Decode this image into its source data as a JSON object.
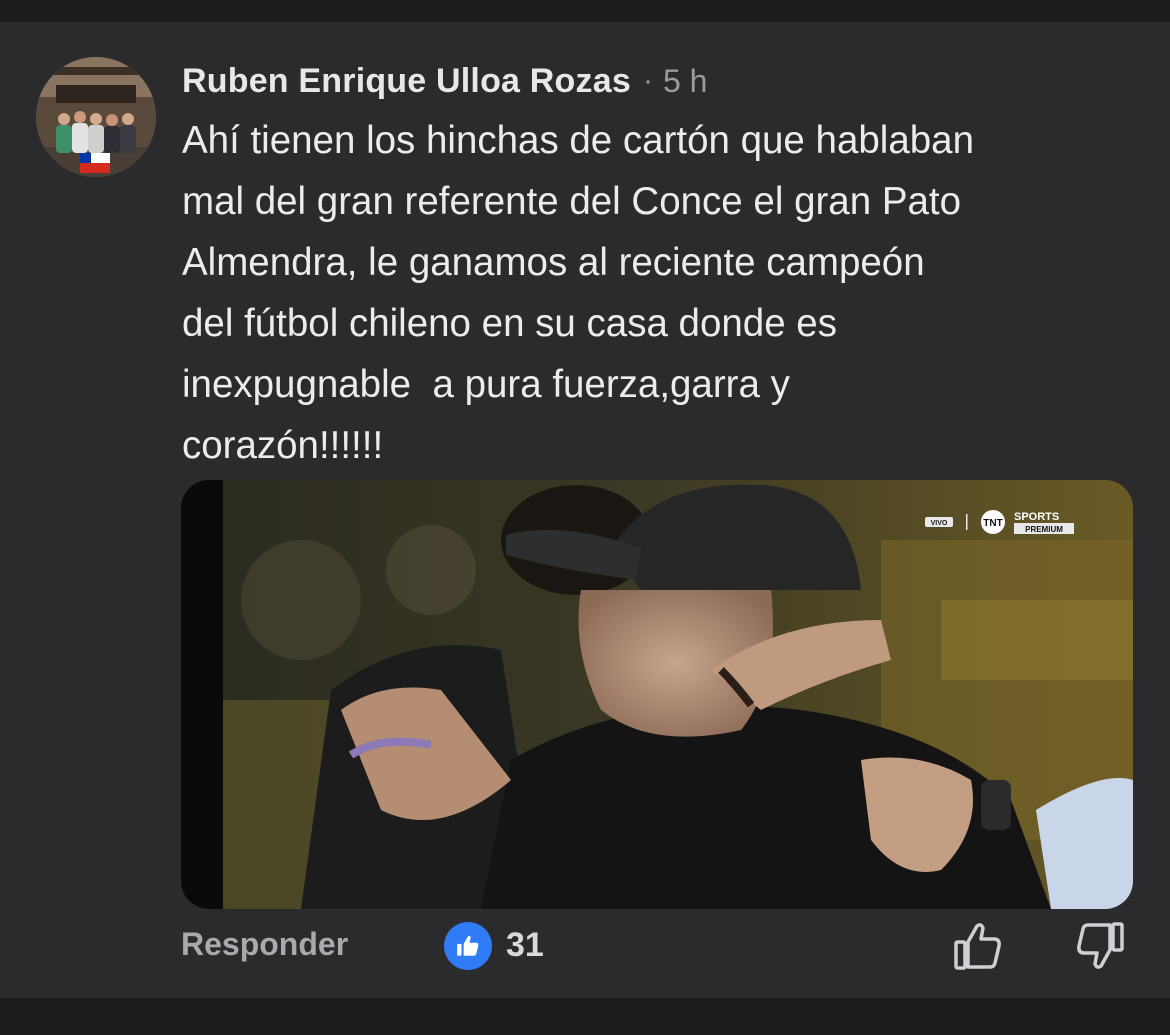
{
  "comment": {
    "author": "Ruben Enrique Ulloa Rozas",
    "separator": "·",
    "time": "5 h",
    "text": "Ahí tienen los hinchas de cartón que hablaban\nmal del gran referente del Conce el gran Pato\nAlmendra, le ganamos al reciente campeón\ndel fútbol chileno en su casa donde es\ninexpugnable  a pura fuerza,garra y\ncorazón!!!!!!"
  },
  "media": {
    "broadcast_live": "VIVO",
    "broadcast_logo": "TNT",
    "broadcast_brand": "SPORTS",
    "broadcast_tier": "PREMIUM"
  },
  "actions": {
    "reply_label": "Responder",
    "like_count": "31",
    "like_icon": "thumbs-up-icon",
    "upvote_icon": "thumb-up-outline-icon",
    "downvote_icon": "thumb-down-outline-icon"
  },
  "colors": {
    "background": "#2b2b2d",
    "like_badge": "#2f7cf6",
    "text_primary": "#ececee",
    "text_secondary": "#9a9a9f"
  }
}
